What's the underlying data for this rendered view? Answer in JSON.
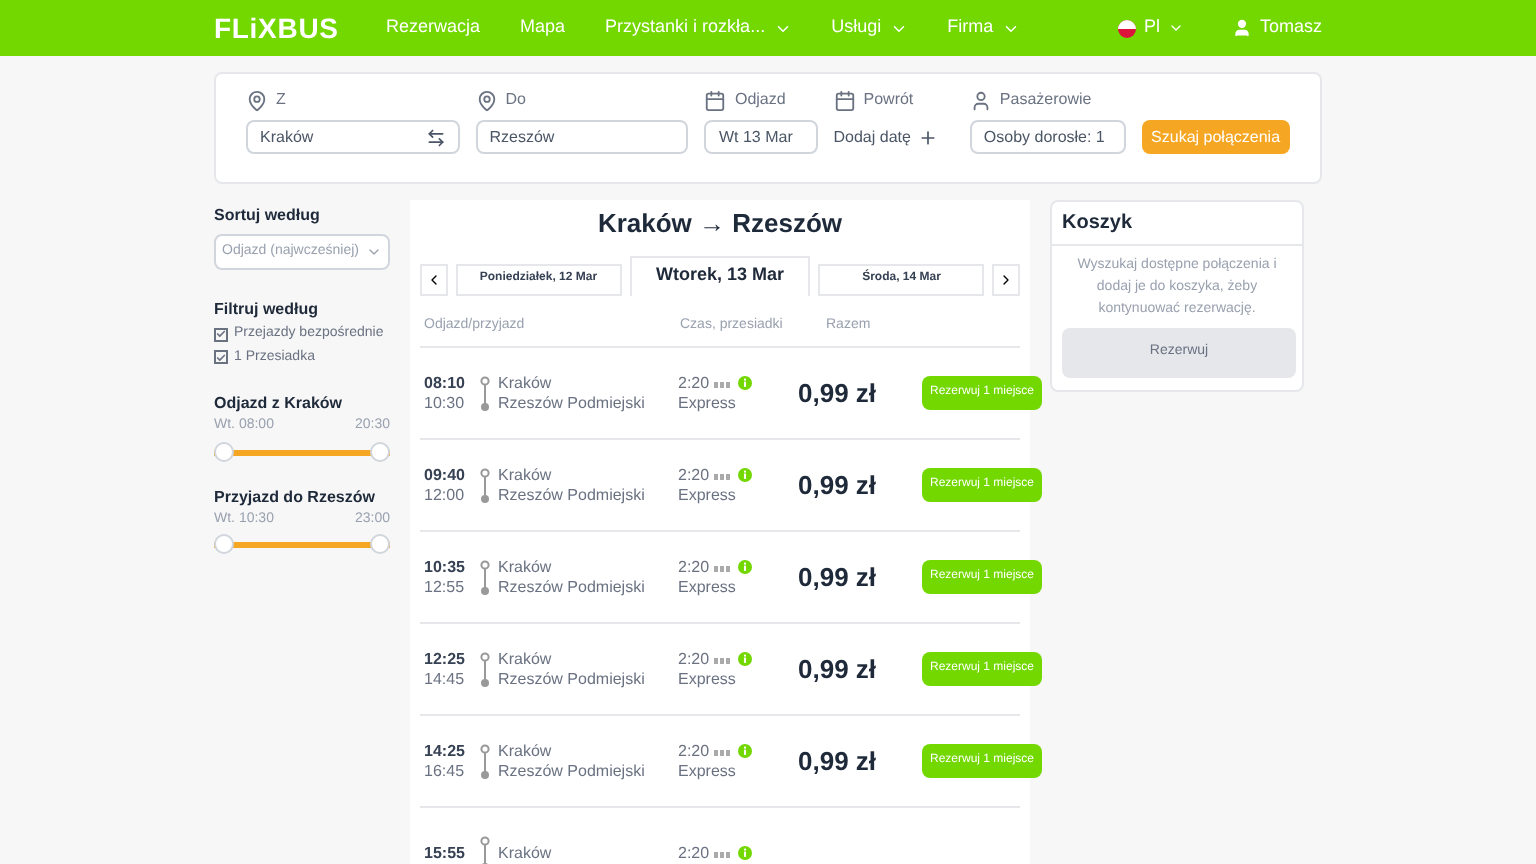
{
  "header": {
    "logo": "FLiXBUS",
    "nav": [
      {
        "label": "Rezerwacja",
        "dropdown": false
      },
      {
        "label": "Mapa",
        "dropdown": false
      },
      {
        "label": "Przystanki i rozkła...",
        "dropdown": true
      },
      {
        "label": "Usługi",
        "dropdown": true
      },
      {
        "label": "Firma",
        "dropdown": true
      }
    ],
    "language": "Pl",
    "user": "Tomasz"
  },
  "search": {
    "from": {
      "label": "Z",
      "value": "Kraków"
    },
    "to": {
      "label": "Do",
      "value": "Rzeszów"
    },
    "departure": {
      "label": "Odjazd",
      "value": "Wt 13 Mar"
    },
    "return": {
      "label": "Powrót",
      "value": "Dodaj datę"
    },
    "passengers": {
      "label": "Pasażerowie",
      "value": "Osoby dorosłe: 1"
    },
    "button": "Szukaj połączenia"
  },
  "sidebar": {
    "sort": {
      "title": "Sortuj według",
      "value": "Odjazd (najwcześniej)"
    },
    "filter": {
      "title": "Filtruj według",
      "options": [
        {
          "label": "Przejazdy bezpośrednie",
          "checked": true
        },
        {
          "label": "1 Przesiadka",
          "checked": true
        }
      ]
    },
    "sliders": [
      {
        "title": "Odjazd z Kraków",
        "min_label": "Wt. 08:00",
        "max_label": "20:30",
        "level": 1
      },
      {
        "title": "Przyjazd do Rzeszów",
        "min_label": "Wt. 10:30",
        "max_label": "23:00",
        "level": 1
      }
    ]
  },
  "results": {
    "title": "Kraków → Rzeszów",
    "days": [
      {
        "label": "Poniedziałek, 12 Mar",
        "selected": false
      },
      {
        "label": "Wtorek, 13 Mar",
        "selected": true
      },
      {
        "label": "Środa, 14 Mar",
        "selected": false
      }
    ],
    "columns": [
      "Odjazd/przyjazd",
      "Czas, przesiadki",
      "Razem"
    ],
    "rows": [
      {
        "dep": "08:10",
        "arr": "10:30",
        "from": "Kraków",
        "to": "Rzeszów Podmiejski",
        "duration": "2:20",
        "type": "Express",
        "price": "0,99 zł",
        "button": "Rezerwuj 1 miejsce"
      },
      {
        "dep": "09:40",
        "arr": "12:00",
        "from": "Kraków",
        "to": "Rzeszów Podmiejski",
        "duration": "2:20",
        "type": "Express",
        "price": "0,99 zł",
        "button": "Rezerwuj 1 miejsce"
      },
      {
        "dep": "10:35",
        "arr": "12:55",
        "from": "Kraków",
        "to": "Rzeszów Podmiejski",
        "duration": "2:20",
        "type": "Express",
        "price": "0,99 zł",
        "button": "Rezerwuj 1 miejsce"
      },
      {
        "dep": "12:25",
        "arr": "14:45",
        "from": "Kraków",
        "to": "Rzeszów Podmiejski",
        "duration": "2:20",
        "type": "Express",
        "price": "0,99 zł",
        "button": "Rezerwuj 1 miejsce"
      },
      {
        "dep": "14:25",
        "arr": "16:45",
        "from": "Kraków",
        "to": "Rzeszów Podmiejski",
        "duration": "2:20",
        "type": "Express",
        "price": "0,99 zł",
        "button": "Rezerwuj 1 miejsce"
      },
      {
        "dep": "15:55",
        "from": "Kraków",
        "duration": "2:20"
      }
    ]
  },
  "cart": {
    "title": "Koszyk",
    "text": "Wyszukaj dostępne połączenia i dodaj je do koszyka, żeby kontynuować rezerwację.",
    "button": "Rezerwuj",
    "button_disabled": true
  }
}
